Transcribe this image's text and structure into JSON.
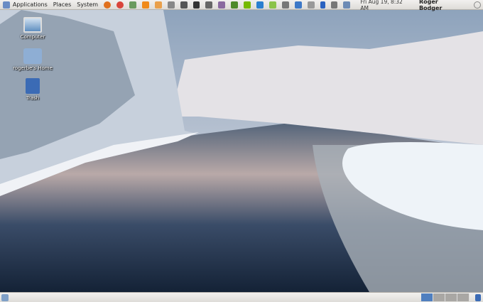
{
  "top_panel": {
    "menus": [
      "Applications",
      "Places",
      "System"
    ],
    "launchers": [
      "firefox-icon",
      "chrome-icon",
      "media-player-icon",
      "vlc-icon",
      "wine-icon",
      "search-tool-icon",
      "camera-icon",
      "terminal-icon",
      "monitor-icon",
      "notes-icon",
      "system-monitor-icon",
      "nvidia-icon",
      "remote-desktop-icon",
      "android-icon",
      "screenshot-icon"
    ],
    "tray": [
      "network-icon",
      "volume-icon",
      "bluetooth-icon",
      "signal-icon",
      "battery-icon"
    ],
    "clock": "Fri Aug 19,  8:32 AM",
    "user": "Roger Bodger"
  },
  "desktop_icons": [
    {
      "label": "Computer",
      "icon": "computer-icon"
    },
    {
      "label": "rogerbe's Home",
      "icon": "home-folder-icon"
    },
    {
      "label": "Trash",
      "icon": "trash-icon"
    }
  ],
  "bottom_panel": {
    "workspaces": 4,
    "active_workspace": 1
  }
}
